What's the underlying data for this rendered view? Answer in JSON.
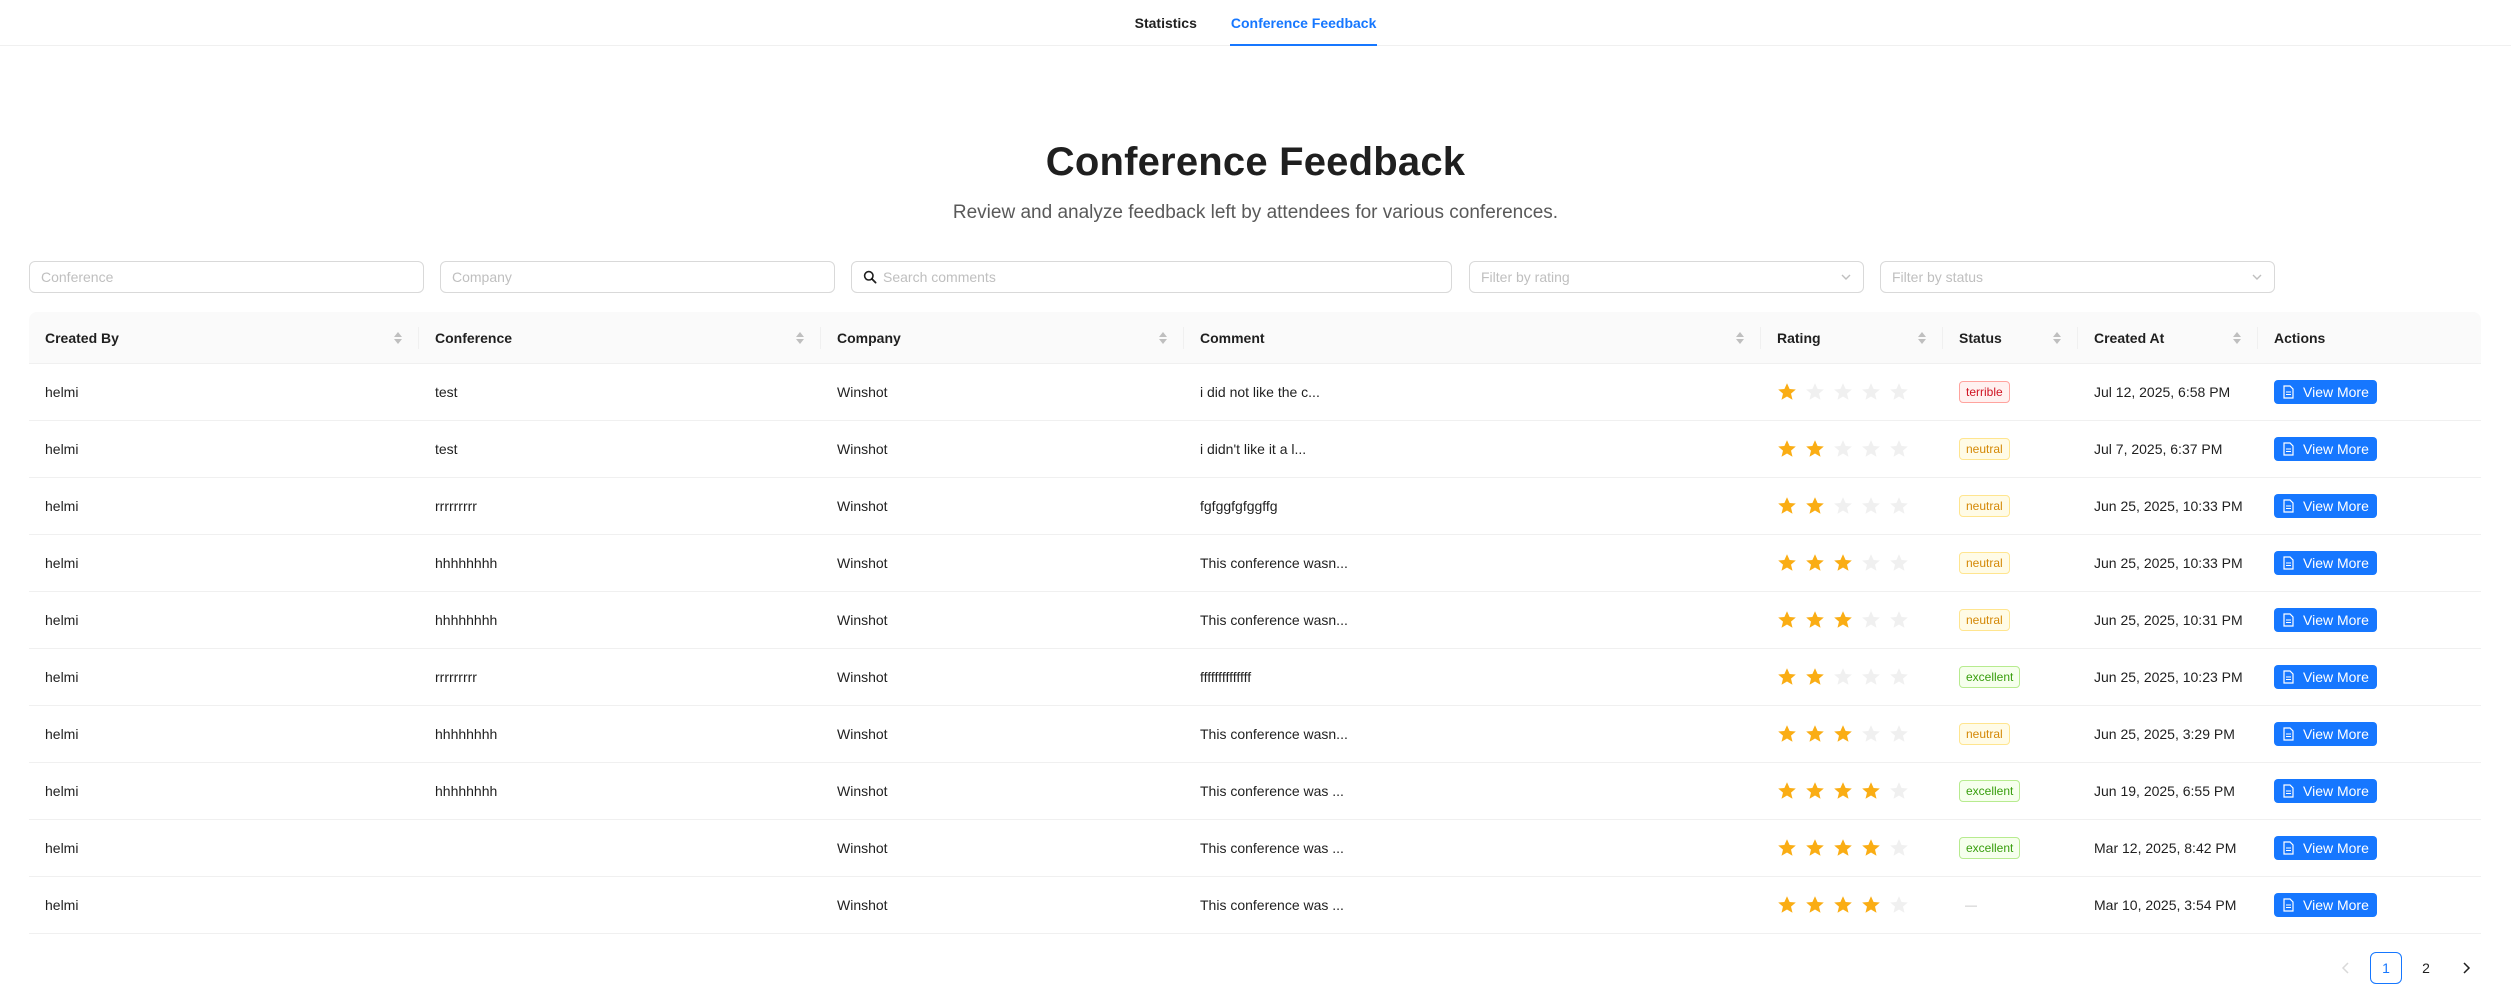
{
  "nav": {
    "tabs": [
      {
        "label": "Statistics",
        "active": false
      },
      {
        "label": "Conference Feedback",
        "active": true
      }
    ]
  },
  "header": {
    "title": "Conference Feedback",
    "subtitle": "Review and analyze feedback left by attendees for various conferences."
  },
  "filters": {
    "conference_placeholder": "Conference",
    "company_placeholder": "Company",
    "search_placeholder": "Search comments",
    "rating_placeholder": "Filter by rating",
    "status_placeholder": "Filter by status"
  },
  "table": {
    "columns": [
      "Created By",
      "Conference",
      "Company",
      "Comment",
      "Rating",
      "Status",
      "Created At",
      "Actions"
    ],
    "action_label": "View More",
    "rows": [
      {
        "created_by": "helmi",
        "conference": "test",
        "company": "Winshot",
        "comment": "i did not like the c...",
        "rating": 1,
        "status": "terrible",
        "created_at": "Jul 12, 2025, 6:58 PM"
      },
      {
        "created_by": "helmi",
        "conference": "test",
        "company": "Winshot",
        "comment": "i didn't like it a l...",
        "rating": 2,
        "status": "neutral",
        "created_at": "Jul 7, 2025, 6:37 PM"
      },
      {
        "created_by": "helmi",
        "conference": "rrrrrrrrr",
        "company": "Winshot",
        "comment": "fgfggfgfggffg",
        "rating": 2,
        "status": "neutral",
        "created_at": "Jun 25, 2025, 10:33 PM"
      },
      {
        "created_by": "helmi",
        "conference": "hhhhhhhh",
        "company": "Winshot",
        "comment": "This conference wasn...",
        "rating": 3,
        "status": "neutral",
        "created_at": "Jun 25, 2025, 10:33 PM"
      },
      {
        "created_by": "helmi",
        "conference": "hhhhhhhh",
        "company": "Winshot",
        "comment": "This conference wasn...",
        "rating": 3,
        "status": "neutral",
        "created_at": "Jun 25, 2025, 10:31 PM"
      },
      {
        "created_by": "helmi",
        "conference": "rrrrrrrrr",
        "company": "Winshot",
        "comment": "ffffffffffffff",
        "rating": 2,
        "status": "excellent",
        "created_at": "Jun 25, 2025, 10:23 PM"
      },
      {
        "created_by": "helmi",
        "conference": "hhhhhhhh",
        "company": "Winshot",
        "comment": "This conference wasn...",
        "rating": 3,
        "status": "neutral",
        "created_at": "Jun 25, 2025, 3:29 PM"
      },
      {
        "created_by": "helmi",
        "conference": "hhhhhhhh",
        "company": "Winshot",
        "comment": "This conference was ...",
        "rating": 4,
        "status": "excellent",
        "created_at": "Jun 19, 2025, 6:55 PM"
      },
      {
        "created_by": "helmi",
        "conference": "",
        "company": "Winshot",
        "comment": "This conference was ...",
        "rating": 4,
        "status": "excellent",
        "created_at": "Mar 12, 2025, 8:42 PM"
      },
      {
        "created_by": "helmi",
        "conference": "",
        "company": "Winshot",
        "comment": "This conference was ...",
        "rating": 4,
        "status": "—",
        "created_at": "Mar 10, 2025, 3:54 PM"
      }
    ]
  },
  "pagination": {
    "pages": [
      "1",
      "2"
    ],
    "current": "1"
  },
  "colors": {
    "primary": "#1677ff",
    "star_filled": "#fadb14",
    "star_empty": "#f0f0f0"
  }
}
